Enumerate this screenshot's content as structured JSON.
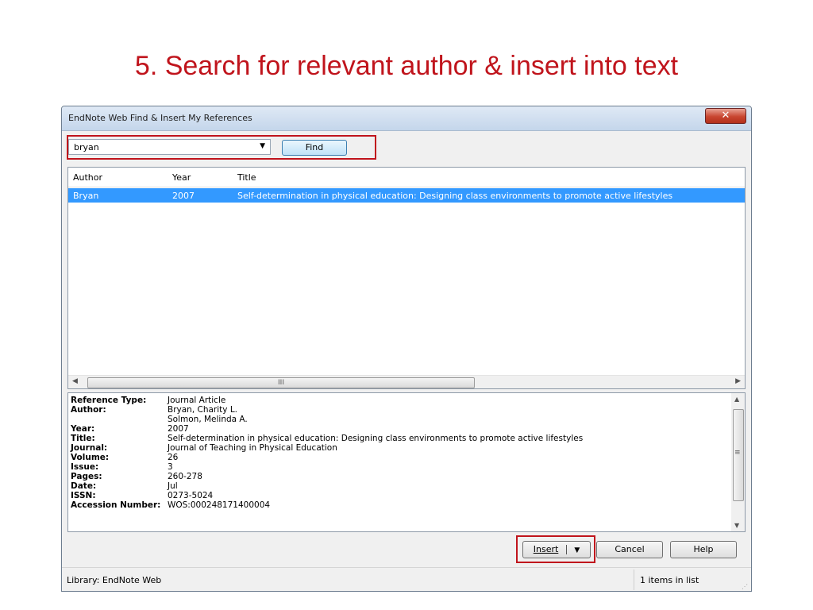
{
  "slide_title": "5. Search for relevant author & insert into text",
  "window": {
    "title": "EndNote Web Find & Insert My References",
    "close_glyph": "✕"
  },
  "search": {
    "value": "bryan",
    "find_label": "Find"
  },
  "list": {
    "columns": [
      "Author",
      "Year",
      "Title"
    ],
    "rows": [
      {
        "author": "Bryan",
        "year": "2007",
        "title": "Self-determination in physical education: Designing class environments to promote active lifestyles",
        "selected": true
      }
    ],
    "scroll_grip": "III"
  },
  "details": [
    {
      "label": "Reference Type:",
      "value": "Journal Article"
    },
    {
      "label": "Author:",
      "value": "Bryan, Charity L."
    },
    {
      "label": "",
      "value": "Solmon, Melinda A."
    },
    {
      "label": "Year:",
      "value": "2007"
    },
    {
      "label": "Title:",
      "value": "Self-determination in physical education: Designing class environments to promote active lifestyles"
    },
    {
      "label": "Journal:",
      "value": "Journal of Teaching in Physical Education"
    },
    {
      "label": "Volume:",
      "value": "26"
    },
    {
      "label": "Issue:",
      "value": "3"
    },
    {
      "label": "Pages:",
      "value": "260-278"
    },
    {
      "label": "Date:",
      "value": "Jul"
    },
    {
      "label": "ISSN:",
      "value": "0273-5024"
    },
    {
      "label": "Accession Number:",
      "value": "WOS:000248171400004"
    }
  ],
  "buttons": {
    "insert": "Insert",
    "cancel": "Cancel",
    "help": "Help"
  },
  "status": {
    "library": "Library: EndNote Web",
    "count": "1 items in list"
  },
  "colors": {
    "highlight": "#c0141c",
    "selection": "#3399ff",
    "slide_title": "#c0141c"
  }
}
